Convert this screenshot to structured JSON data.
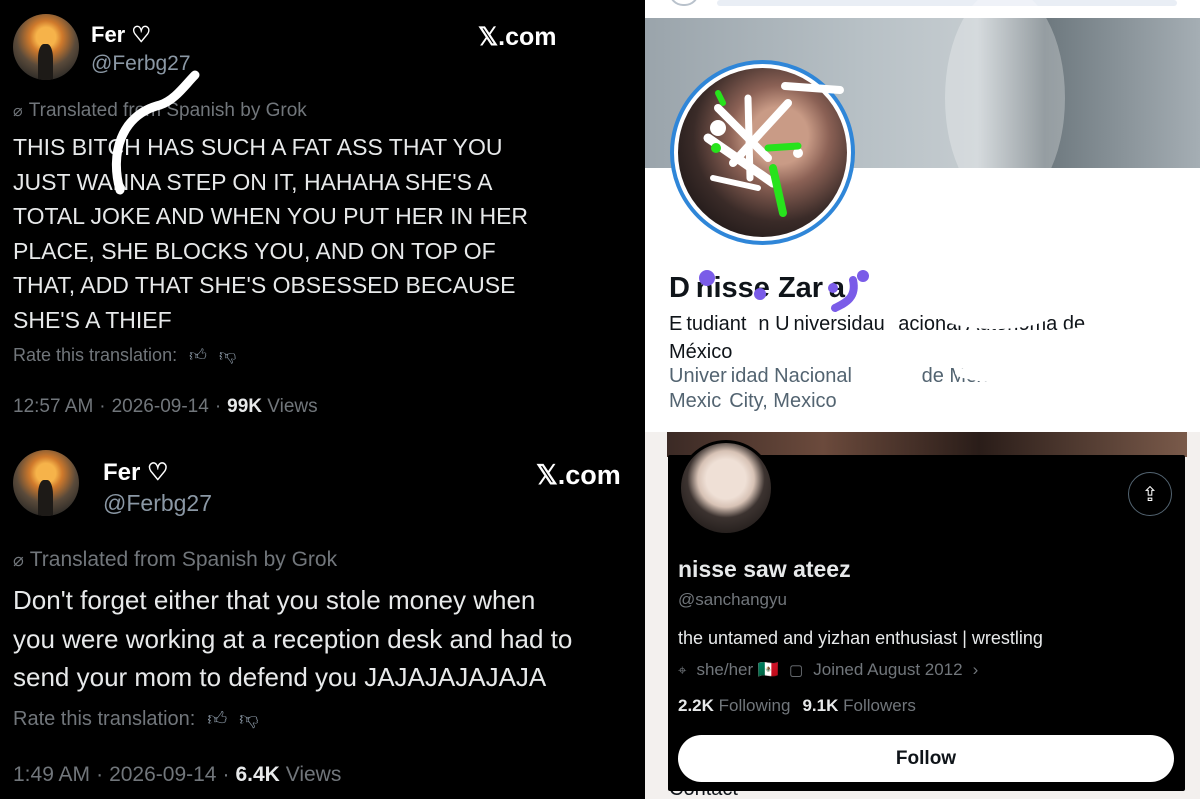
{
  "tweets": [
    {
      "author": "Fer ♡",
      "handle": "@Ferbg27",
      "brand": "𝕏.com",
      "translated_label": "Translated from Spanish by Grok",
      "text_lines": [
        "THIS BITCH HAS SUCH A FAT ASS THAT YOU",
        "JUST WANNA STEP ON IT, HAHAHA SHE'S A",
        "TOTAL JOKE AND WHEN YOU PUT HER IN HER",
        "PLACE, SHE BLOCKS YOU, AND ON TOP OF",
        "THAT, ADD THAT SHE'S OBSESSED BECAUSE",
        "SHE'S A THIEF"
      ],
      "rate_label": "Rate this translation:",
      "time": "12:57 AM",
      "date": "2026-09-14",
      "views_count": "99K",
      "views_label": "Views"
    },
    {
      "author": "Fer ♡",
      "handle": "@Ferbg27",
      "brand": "𝕏.com",
      "translated_label": "Translated from Spanish by Grok",
      "text_lines": [
        "Don't forget either that you stole money when",
        "you were working at a reception desk and had to",
        "send your mom to defend you JAJAJAJAJAJA"
      ],
      "rate_label": "Rate this translation:",
      "time": "1:49 AM",
      "date": "2026-09-14",
      "views_count": "6.4K",
      "views_label": "Views"
    }
  ],
  "profile": {
    "name": "D nisse Zar a",
    "bio_line1": "E tudiant   n U niversidau   acional Autónoma de",
    "bio_line2": "México",
    "school": "Univer idad Nacional                 de México",
    "location": "Mexic  City, Mexico",
    "contact": "Contact"
  },
  "card": {
    "name": "nisse saw ateez",
    "handle": "@sanchangyu",
    "bio": "the untamed and yizhan enthusiast | wrestling",
    "pronouns": "she/her 🇲🇽",
    "joined": "Joined August 2012",
    "following_count": "2.2K",
    "following_label": "Following",
    "followers_count": "9.1K",
    "followers_label": "Followers",
    "follow_label": "Follow"
  },
  "icons": {
    "translate": "translate-icon",
    "thumbs_up": "thumbs-up-icon",
    "thumbs_down": "thumbs-down-icon",
    "share": "share-icon",
    "location": "location-pin-icon",
    "calendar": "calendar-icon"
  },
  "colors": {
    "scribble_white": "#ffffff",
    "scribble_green": "#27e31c",
    "scribble_purple": "#7a5ce8",
    "avatar_ring": "#2f86d8"
  }
}
